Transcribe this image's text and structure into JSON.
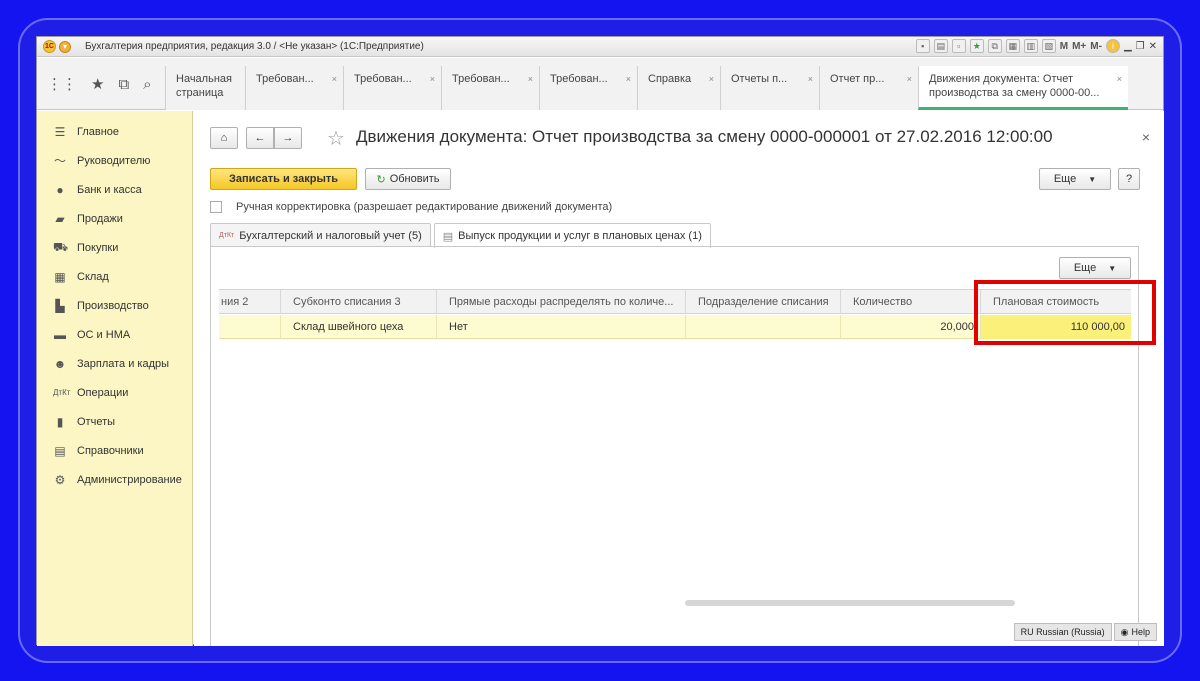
{
  "app": {
    "title": "Бухгалтерия предприятия, редакция 3.0 / <Не указан>  (1С:Предприятие)",
    "logo_text": "1С",
    "title_buttons": [
      "M",
      "M+",
      "M-"
    ]
  },
  "nav": {
    "tabs": [
      {
        "label": "Начальная\nстраница",
        "closable": false
      },
      {
        "label": "Требован...",
        "closable": true
      },
      {
        "label": "Требован...",
        "closable": true
      },
      {
        "label": "Требован...",
        "closable": true
      },
      {
        "label": "Требован...",
        "closable": true
      },
      {
        "label": "Справка",
        "closable": true
      },
      {
        "label": "Отчеты п...",
        "closable": true
      },
      {
        "label": "Отчет пр...",
        "closable": true
      },
      {
        "label": "Движения документа: Отчет производства за смену 0000-00...",
        "closable": true,
        "active": true
      }
    ],
    "close_glyph": "×"
  },
  "sidebar": {
    "items": [
      {
        "label": "Главное",
        "icon": "menu-lines-icon"
      },
      {
        "label": "Руководителю",
        "icon": "trend-chart-icon"
      },
      {
        "label": "Банк и касса",
        "icon": "ruble-coin-icon"
      },
      {
        "label": "Продажи",
        "icon": "shopping-bag-icon"
      },
      {
        "label": "Покупки",
        "icon": "cart-icon"
      },
      {
        "label": "Склад",
        "icon": "warehouse-grid-icon"
      },
      {
        "label": "Производство",
        "icon": "factory-icon"
      },
      {
        "label": "ОС и НМА",
        "icon": "truck-icon"
      },
      {
        "label": "Зарплата и кадры",
        "icon": "people-icon"
      },
      {
        "label": "Операции",
        "icon": "dt-kt-icon"
      },
      {
        "label": "Отчеты",
        "icon": "bar-chart-icon"
      },
      {
        "label": "Справочники",
        "icon": "book-icon"
      },
      {
        "label": "Администрирование",
        "icon": "gear-icon"
      }
    ]
  },
  "document": {
    "title": "Движения документа: Отчет производства за смену 0000-000001 от 27.02.2016 12:00:00",
    "save_close_label": "Записать и закрыть",
    "refresh_label": "Обновить",
    "more_label": "Еще",
    "help_label": "?",
    "manual_correction_label": "Ручная корректировка (разрешает редактирование движений документа)",
    "tabs": [
      {
        "label": "Бухгалтерский и налоговый учет (5)",
        "active": false
      },
      {
        "label": "Выпуск продукции и услуг в плановых ценах (1)",
        "active": true
      }
    ],
    "grid_more_label": "Еще"
  },
  "grid": {
    "columns": [
      "ния 2",
      "Субконто списания 3",
      "Прямые расходы распределять по количе...",
      "Подразделение списания",
      "Количество",
      "Плановая стоимость"
    ],
    "rows": [
      [
        "",
        "Склад швейного цеха",
        "Нет",
        "",
        "20,000",
        "110 000,00"
      ]
    ]
  },
  "status": {
    "language": "RU Russian (Russia)",
    "help": "Help"
  },
  "colors": {
    "highlight": "#e10000",
    "sidebar_bg": "#fbf6c4",
    "accent_green": "#3cb371",
    "primary_button": "#f5c724"
  }
}
